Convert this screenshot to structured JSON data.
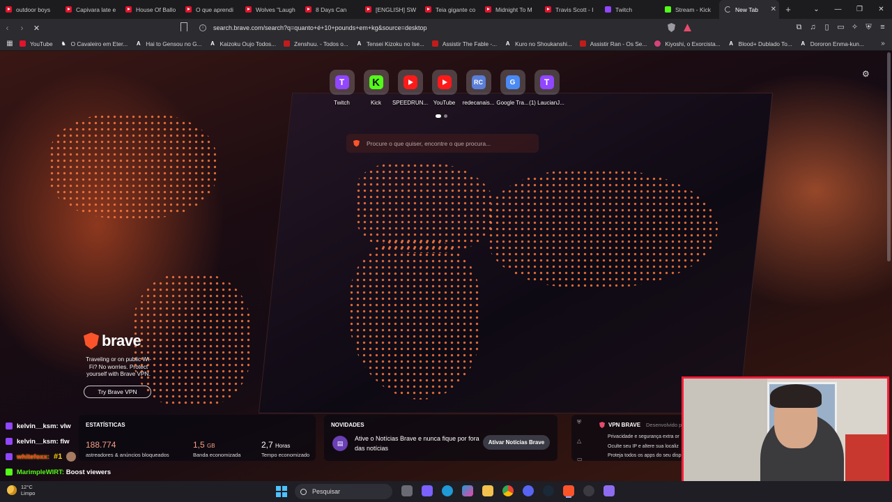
{
  "tabs": [
    {
      "title": "outdoor boys",
      "icon": "youtube-icon"
    },
    {
      "title": "Capivara late e",
      "icon": "youtube-icon"
    },
    {
      "title": "House Of Ballo",
      "icon": "youtube-icon"
    },
    {
      "title": "O que aprendi",
      "icon": "youtube-icon"
    },
    {
      "title": "Wolves \"Laugh",
      "icon": "youtube-icon"
    },
    {
      "title": "8 Days Can",
      "icon": "youtube-icon"
    },
    {
      "title": "[ENGLISH] SW",
      "icon": "youtube-icon"
    },
    {
      "title": "Teia gigante co",
      "icon": "youtube-icon"
    },
    {
      "title": "Midnight To M",
      "icon": "youtube-icon"
    },
    {
      "title": "Travis Scott - I",
      "icon": "youtube-icon"
    },
    {
      "title": "Twitch",
      "icon": "twitch-icon"
    },
    {
      "title": "Stream - Kick",
      "icon": "kick-icon"
    },
    {
      "title": "New Tab",
      "icon": "loading-spinner-icon"
    }
  ],
  "address": {
    "url": "search.brave.com/search?q=quanto+é+10+pounds+em+kg&source=desktop"
  },
  "bookmarks": [
    {
      "label": "YouTube",
      "icon": "youtube-icon"
    },
    {
      "label": "O Cavaleiro em Eter...",
      "icon": "page-icon"
    },
    {
      "label": "Hai to Gensou no G...",
      "icon": "a-icon"
    },
    {
      "label": "Kaizoku Oujo Todos...",
      "icon": "a-icon"
    },
    {
      "label": "Zenshuu. - Todos o...",
      "icon": "red-icon"
    },
    {
      "label": "Tensei Kizoku no Ise...",
      "icon": "a-icon"
    },
    {
      "label": "Assistir The Fable -...",
      "icon": "red-icon"
    },
    {
      "label": "Kuro no Shoukanshi...",
      "icon": "a-icon"
    },
    {
      "label": "Assistir Ran - Os Se...",
      "icon": "red-icon"
    },
    {
      "label": "Kiyoshi, o Exorcista...",
      "icon": "pink-icon"
    },
    {
      "label": "Blood+ Dublado To...",
      "icon": "a-icon"
    },
    {
      "label": "Dororon Enma-kun...",
      "icon": "a-icon"
    }
  ],
  "topsites": [
    {
      "label": "Twitch",
      "glyph": "T",
      "kind": "tw"
    },
    {
      "label": "Kick",
      "glyph": "K",
      "kind": "kick"
    },
    {
      "label": "SPEEDRUN...",
      "glyph": "",
      "kind": "yt"
    },
    {
      "label": "YouTube",
      "glyph": "",
      "kind": "yt"
    },
    {
      "label": "redecanais...",
      "glyph": "RC",
      "kind": "rc"
    },
    {
      "label": "Google Tra...",
      "glyph": "G",
      "kind": "gt"
    },
    {
      "label": "(1) LaucianJ...",
      "glyph": "T",
      "kind": "tw"
    }
  ],
  "search": {
    "placeholder": "Procure o que quiser, encontre o que procura..."
  },
  "promo": {
    "brand": "brave",
    "text": "Traveling or on public Wi-Fi? No worries. Protect yourself with Brave VPN.",
    "button": "Try Brave VPN"
  },
  "stats": {
    "title": "ESTATÍSTICAS",
    "blocked_value": "188.774",
    "blocked_label": "astreadores & anúncios bloqueados",
    "bandwidth_value": "1,5",
    "bandwidth_unit": "GB",
    "bandwidth_label": "Banda economizada",
    "time_value": "2,7",
    "time_unit": "Horas",
    "time_label": "Tempo economizado"
  },
  "news": {
    "title": "NOVIDADES",
    "text": "Ative o Notícias Brave e nunca fique por fora das notícias",
    "button": "Ativar Notícias Brave"
  },
  "vpn": {
    "title": "VPN BRAVE",
    "status": "Desenvolvido p",
    "features": [
      "Privacidade e segurança extra or",
      "Oculte seu IP e altere sua localiz",
      "Proteja todos os apps do seu disp"
    ]
  },
  "chat": [
    {
      "user": "kelvin__ksm: vlw",
      "platform": "twitch"
    },
    {
      "user": "kelvin__ksm: flw",
      "platform": "twitch"
    },
    {
      "user": "whitefoxx:",
      "badge": "#1",
      "platform": "twitch"
    },
    {
      "user": "MarimpleWIRT:",
      "message": "Boost viewers",
      "platform": "kick"
    }
  ],
  "taskbar": {
    "temp": "12°C",
    "condition": "Limpo",
    "search_label": "Pesquisar"
  }
}
